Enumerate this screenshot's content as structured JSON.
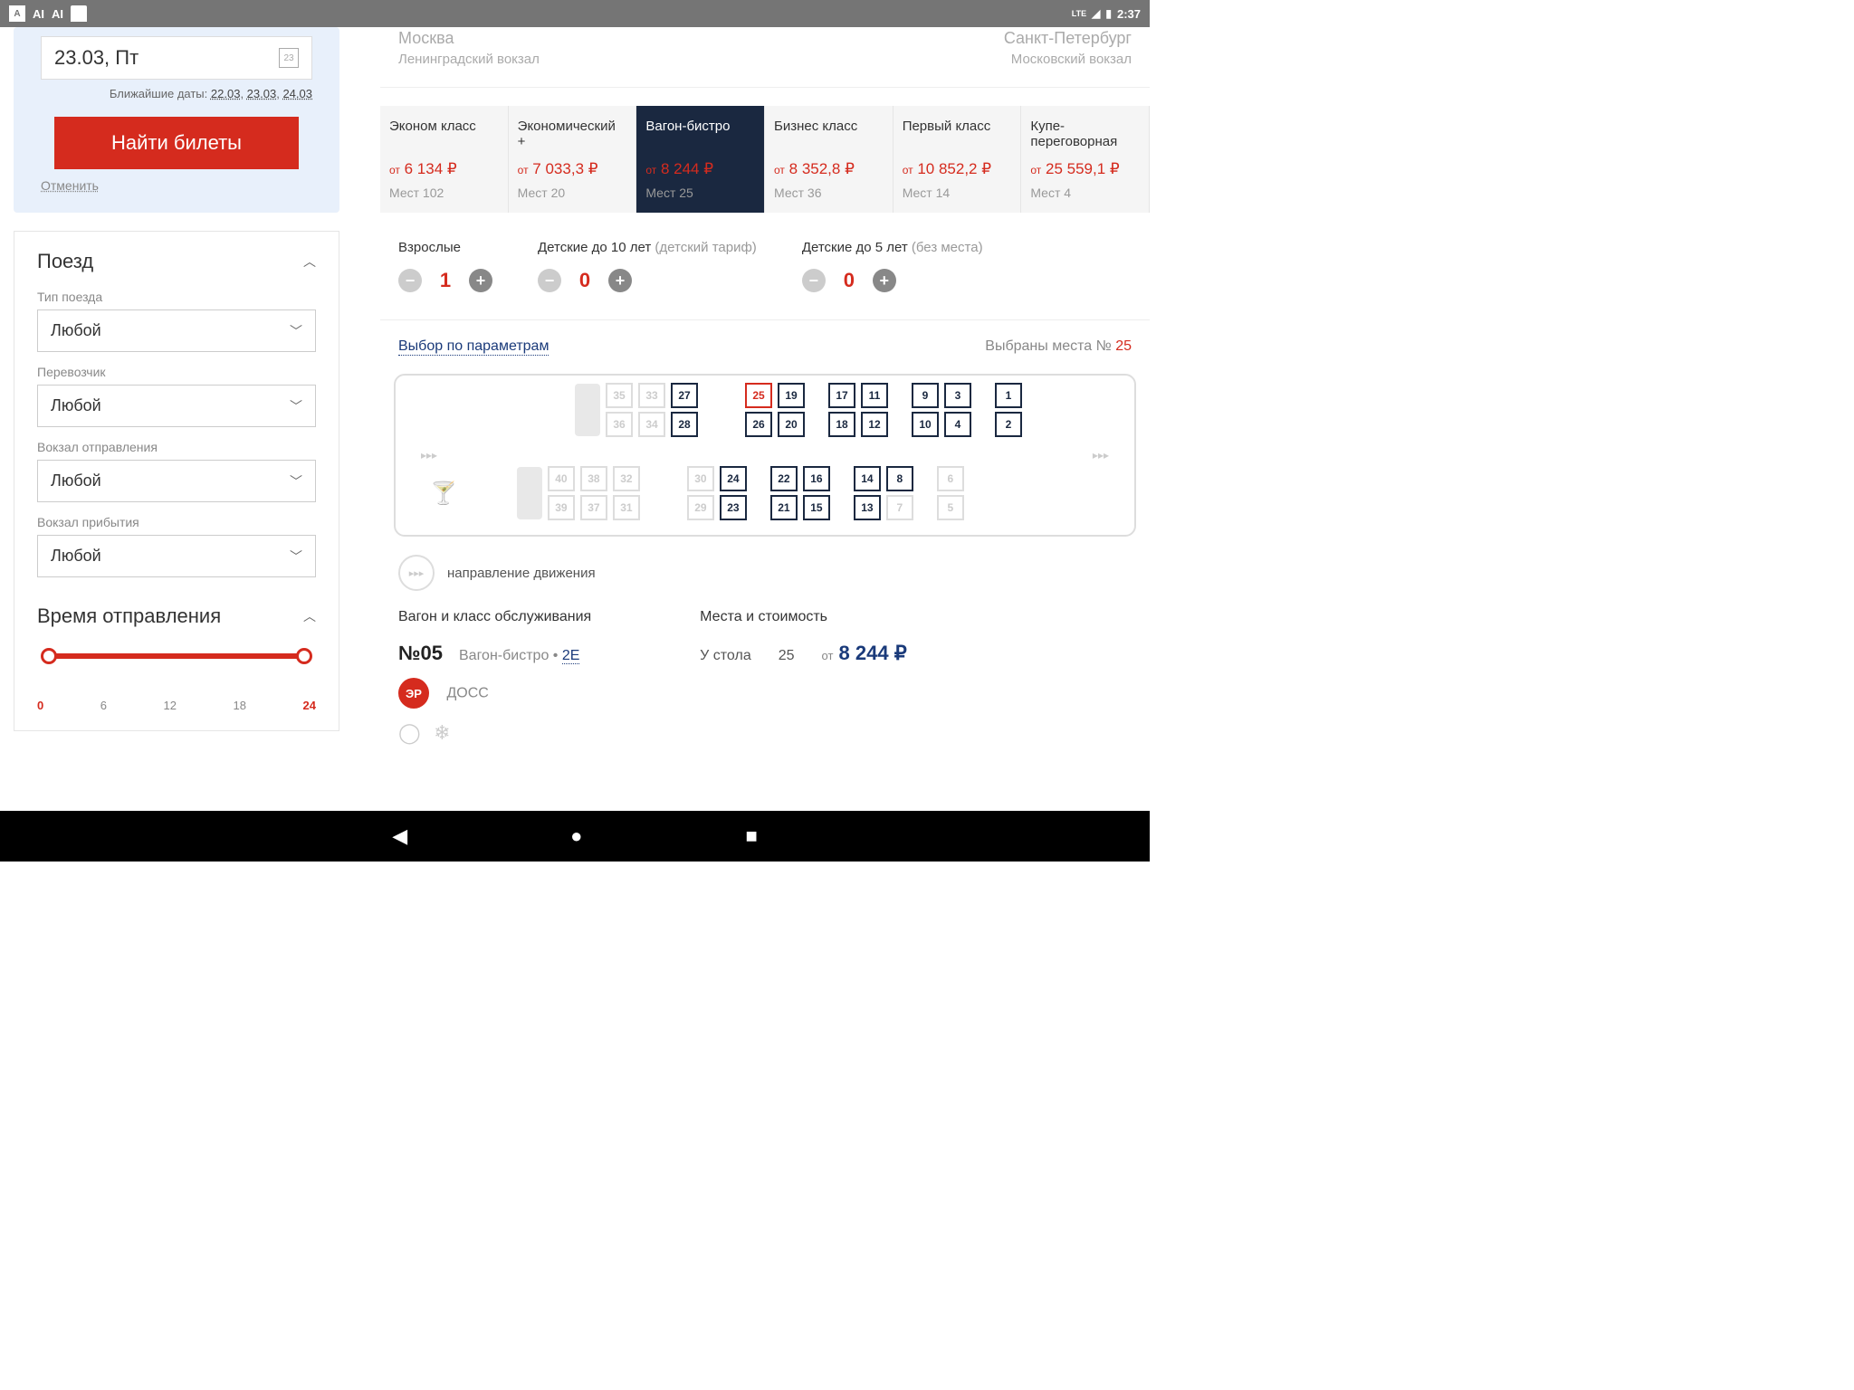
{
  "status": {
    "time": "2:37",
    "lte": "LTE"
  },
  "search": {
    "date": "23.03, Пт",
    "nearest_label": "Ближайшие даты:",
    "nearest": [
      "22.03",
      "23.03",
      "24.03"
    ],
    "find_btn": "Найти билеты",
    "cancel": "Отменить"
  },
  "filters": {
    "train_section": "Поезд",
    "type_label": "Тип поезда",
    "type_value": "Любой",
    "carrier_label": "Перевозчик",
    "carrier_value": "Любой",
    "dep_station_label": "Вокзал отправления",
    "dep_station_value": "Любой",
    "arr_station_label": "Вокзал прибытия",
    "arr_station_value": "Любой",
    "time_section": "Время отправления",
    "slider_ticks": [
      "0",
      "6",
      "12",
      "18",
      "24"
    ]
  },
  "route": {
    "from_city": "Москва",
    "from_station": "Ленинградский вокзал",
    "to_city": "Санкт-Петербург",
    "to_station": "Московский вокзал"
  },
  "classes": [
    {
      "name": "Эконом класс",
      "price": "6 134 ₽",
      "seats": "Мест 102"
    },
    {
      "name": "Экономический +",
      "price": "7 033,3 ₽",
      "seats": "Мест 20"
    },
    {
      "name": "Вагон-бистро",
      "price": "8 244 ₽",
      "seats": "Мест 25"
    },
    {
      "name": "Бизнес класс",
      "price": "8 352,8 ₽",
      "seats": "Мест 36"
    },
    {
      "name": "Первый класс",
      "price": "10 852,2 ₽",
      "seats": "Мест 14"
    },
    {
      "name": "Купе-переговорная",
      "price": "25 559,1 ₽",
      "seats": "Мест 4"
    }
  ],
  "ot": "от",
  "passengers": {
    "adults_label": "Взрослые",
    "adults_value": "1",
    "child10_label": "Детские до 10 лет",
    "child10_sub": "(детский тариф)",
    "child10_value": "0",
    "child5_label": "Детские до 5 лет",
    "child5_sub": "(без места)",
    "child5_value": "0"
  },
  "params": {
    "link": "Выбор по параметрам",
    "selected_label": "Выбраны места №",
    "selected_num": "25"
  },
  "seatmap": {
    "top": [
      {
        "cols": [
          [
            "35",
            "u"
          ],
          [
            "36",
            "u"
          ]
        ],
        "sofa": true
      },
      {
        "cols": [
          [
            "33",
            "u"
          ],
          [
            "34",
            "u"
          ]
        ]
      },
      {
        "cols": [
          [
            "27",
            "a"
          ],
          [
            "28",
            "a"
          ]
        ]
      },
      {
        "gap": "big"
      },
      {
        "cols": [
          [
            "25",
            "s"
          ],
          [
            "26",
            "a"
          ]
        ]
      },
      {
        "cols": [
          [
            "19",
            "a"
          ],
          [
            "20",
            "a"
          ]
        ]
      },
      {
        "gap": "mid"
      },
      {
        "cols": [
          [
            "17",
            "a"
          ],
          [
            "18",
            "a"
          ]
        ]
      },
      {
        "cols": [
          [
            "11",
            "a"
          ],
          [
            "12",
            "a"
          ]
        ]
      },
      {
        "gap": "mid"
      },
      {
        "cols": [
          [
            "9",
            "a"
          ],
          [
            "10",
            "a"
          ]
        ]
      },
      {
        "cols": [
          [
            "3",
            "a"
          ],
          [
            "4",
            "a"
          ]
        ]
      },
      {
        "gap": "mid"
      },
      {
        "cols": [
          [
            "1",
            "a"
          ],
          [
            "2",
            "a"
          ]
        ]
      }
    ],
    "bottom": [
      {
        "cocktail": true
      },
      {
        "cols": [
          [
            "40",
            "u"
          ],
          [
            "39",
            "u"
          ]
        ],
        "sofa": true
      },
      {
        "cols": [
          [
            "38",
            "u"
          ],
          [
            "37",
            "u"
          ]
        ]
      },
      {
        "cols": [
          [
            "32",
            "u"
          ],
          [
            "31",
            "u"
          ]
        ]
      },
      {
        "gap": "big"
      },
      {
        "cols": [
          [
            "30",
            "u"
          ],
          [
            "29",
            "u"
          ]
        ]
      },
      {
        "cols": [
          [
            "24",
            "a"
          ],
          [
            "23",
            "a"
          ]
        ]
      },
      {
        "gap": "mid"
      },
      {
        "cols": [
          [
            "22",
            "a"
          ],
          [
            "21",
            "a"
          ]
        ]
      },
      {
        "cols": [
          [
            "16",
            "a"
          ],
          [
            "15",
            "a"
          ]
        ]
      },
      {
        "gap": "mid"
      },
      {
        "cols": [
          [
            "14",
            "a"
          ],
          [
            "13",
            "a"
          ]
        ]
      },
      {
        "cols": [
          [
            "8",
            "a"
          ],
          [
            "7",
            "u"
          ]
        ]
      },
      {
        "gap": "mid"
      },
      {
        "cols": [
          [
            "6",
            "u"
          ],
          [
            "5",
            "u"
          ]
        ]
      }
    ]
  },
  "direction": "направление движения",
  "summary": {
    "car_label": "Вагон и класс обслуживания",
    "car_num": "№05",
    "car_type": "Вагон-бистро",
    "car_class": "2Е",
    "doss": "ДОСС",
    "er": "ЭР",
    "seats_label": "Места и стоимость",
    "table": "У стола",
    "seat_num": "25",
    "price": "8 244 ₽"
  }
}
